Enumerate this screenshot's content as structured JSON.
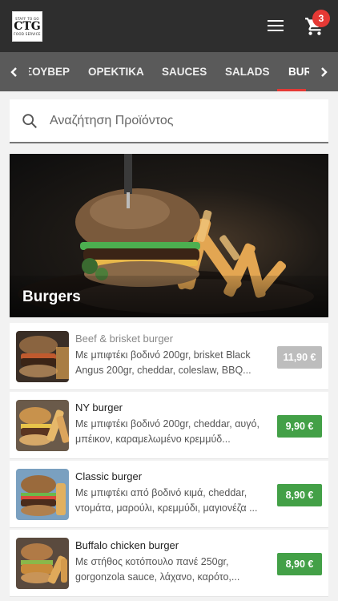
{
  "header": {
    "logo": {
      "top_text": "STAFF TO GO",
      "main_text": "CTG",
      "bottom_text": "FOOD SERVICE"
    },
    "cart_count": "3",
    "icons": {
      "menu": "hamburger-menu-icon",
      "cart": "shopping-cart-icon"
    }
  },
  "categories": {
    "tabs": [
      {
        "label": "ΣΟΥΒΕΡ"
      },
      {
        "label": "ΟΡΕΚΤΙΚΑ"
      },
      {
        "label": "SAUCES"
      },
      {
        "label": "SALADS"
      },
      {
        "label": "BURGERS",
        "active": true
      }
    ],
    "accent_color": "#e53935"
  },
  "search": {
    "placeholder": "Αναζήτηση Προϊόντος",
    "value": ""
  },
  "banner": {
    "title": "Burgers"
  },
  "products": [
    {
      "name": "Beef & brisket burger",
      "description": "Με μπιφτέκι βοδινό 200gr, brisket Black Angus 200gr, cheddar, coleslaw, BBQ...",
      "price": "11,90 €",
      "available": false
    },
    {
      "name": "NY burger",
      "description": "Με μπιφτέκι βοδινό 200gr, cheddar, αυγό, μπέικον, καραμελωμένο κρεμμύδ...",
      "price": "9,90 €",
      "available": true
    },
    {
      "name": "Classic burger",
      "description": "Με μπιφτέκι από βοδινό κιμά, cheddar, ντομάτα, μαρούλι, κρεμμύδι, μαγιονέζα ...",
      "price": "8,90 €",
      "available": true
    },
    {
      "name": "Buffalo chicken burger",
      "description": "Με στήθος κοτόπουλο πανέ 250gr, gorgonzola sauce, λάχανο, καρότο,...",
      "price": "8,90 €",
      "available": true
    }
  ],
  "colors": {
    "available_price": "#43a047",
    "unavailable_price": "#bdbdbd",
    "header_bg": "#2e2e2e",
    "tabbar_bg": "#5a5a5a"
  }
}
